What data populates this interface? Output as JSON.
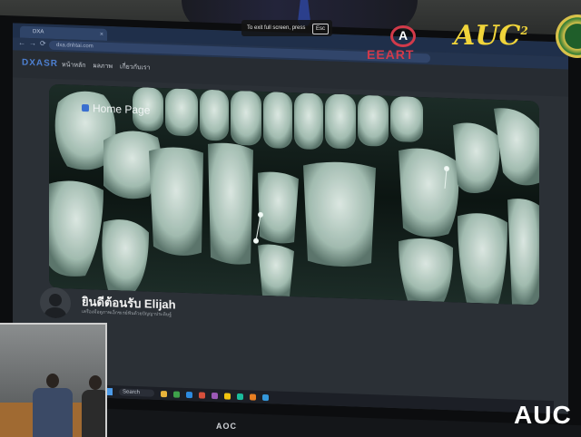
{
  "stream_overlay": {
    "fullscreen_hint": "To exit full screen, press",
    "esc_key": "Esc",
    "logo_eeart": "EEART",
    "logo_auc": "AUC",
    "logo_auc_sup": "2",
    "bottom_brand": "AUC"
  },
  "browser": {
    "tab_title": "DXA",
    "tab_close": "×",
    "url": "dxa.dnhtai.com"
  },
  "site": {
    "brand": "DXASR",
    "menu": [
      "หน้าหลัก",
      "ผลภาพ",
      "เกี่ยวกับเรา"
    ],
    "hero_label": "Home Page",
    "welcome": "ยินดีต้อนรับ Elijah",
    "subtitle": "เครื่องมือดูภาพเอ็กซเรย์ฟันด้วยปัญญาประดิษฐ์"
  },
  "taskbar": {
    "search": "Search"
  },
  "monitor": {
    "brand": "AOC"
  },
  "colors": {
    "accent_blue": "#3b6fd0",
    "eeart_red": "#d23a4a",
    "auc_gold": "#f0d43a",
    "xray_tint": "#cfe3da"
  }
}
